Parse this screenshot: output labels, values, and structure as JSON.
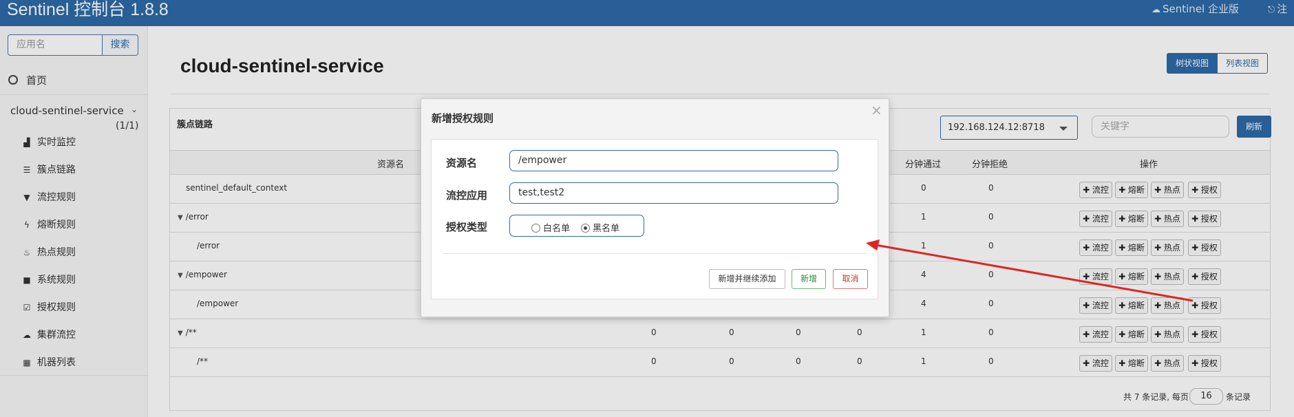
{
  "header": {
    "brand": "Sentinel 控制台 1.8.8",
    "enterprise_link": "Sentinel 企业版",
    "logout_link": "注"
  },
  "sidebar": {
    "search_placeholder": "应用名",
    "search_button": "搜索",
    "home": "首页",
    "app_name": "cloud-sentinel-service",
    "app_count": "(1/1)",
    "items": [
      {
        "label": "实时监控",
        "icon": "bar-chart-icon"
      },
      {
        "label": "簇点链路",
        "icon": "list-icon"
      },
      {
        "label": "流控规则",
        "icon": "filter-icon"
      },
      {
        "label": "熔断规则",
        "icon": "flash-icon"
      },
      {
        "label": "热点规则",
        "icon": "fire-icon"
      },
      {
        "label": "系统规则",
        "icon": "lock-icon"
      },
      {
        "label": "授权规则",
        "icon": "check-icon"
      },
      {
        "label": "集群流控",
        "icon": "cloud-icon"
      },
      {
        "label": "机器列表",
        "icon": "th-list-icon"
      }
    ]
  },
  "main": {
    "title": "cloud-sentinel-service",
    "view_tree": "树状视图",
    "view_list": "列表视图",
    "panel_title": "簇点链路",
    "machine_select": "192.168.124.12:8718",
    "keyword_placeholder": "关键字",
    "refresh_button": "刷新",
    "columns": {
      "resource": "资源名",
      "minute_pass": "分钟通过",
      "minute_block": "分钟拒绝",
      "ops": "操作"
    },
    "ops_labels": [
      "✚ 流控",
      "✚ 熔断",
      "✚ 热点",
      "✚ 授权"
    ],
    "rows": [
      {
        "name": "sentinel_default_context",
        "c1": "",
        "c2": "",
        "c3": "",
        "c4": "",
        "pass": "0",
        "block": "0"
      },
      {
        "name": "/error",
        "c1": "",
        "c2": "",
        "c3": "",
        "c4": "",
        "pass": "1",
        "block": "0"
      },
      {
        "name": "/error",
        "c1": "",
        "c2": "",
        "c3": "",
        "c4": "",
        "pass": "1",
        "block": "0"
      },
      {
        "name": "/empower",
        "c1": "",
        "c2": "",
        "c3": "",
        "c4": "",
        "pass": "4",
        "block": "0"
      },
      {
        "name": "/empower",
        "c1": "",
        "c2": "",
        "c3": "",
        "c4": "",
        "pass": "4",
        "block": "0"
      },
      {
        "name": "/**",
        "c1": "0",
        "c2": "0",
        "c3": "0",
        "c4": "0",
        "pass": "1",
        "block": "0"
      },
      {
        "name": "/**",
        "c1": "0",
        "c2": "0",
        "c3": "0",
        "c4": "0",
        "pass": "1",
        "block": "0"
      }
    ],
    "pager_text": "共 7 条记录, 每页",
    "pager_value": "16",
    "pager_suffix": "条记录"
  },
  "modal": {
    "title": "新增授权规则",
    "close": "×",
    "resource_label": "资源名",
    "resource_value": "/empower",
    "limit_app_label": "流控应用",
    "limit_app_value": "test,test2",
    "strategy_label": "授权类型",
    "whitelist": "白名单",
    "blacklist": "黑名单",
    "selected": "blacklist",
    "btn_add_continue": "新增并继续添加",
    "btn_add": "新增",
    "btn_cancel": "取消"
  },
  "colors": {
    "brand": "#2c6aa8",
    "arrow": "#e02424"
  }
}
